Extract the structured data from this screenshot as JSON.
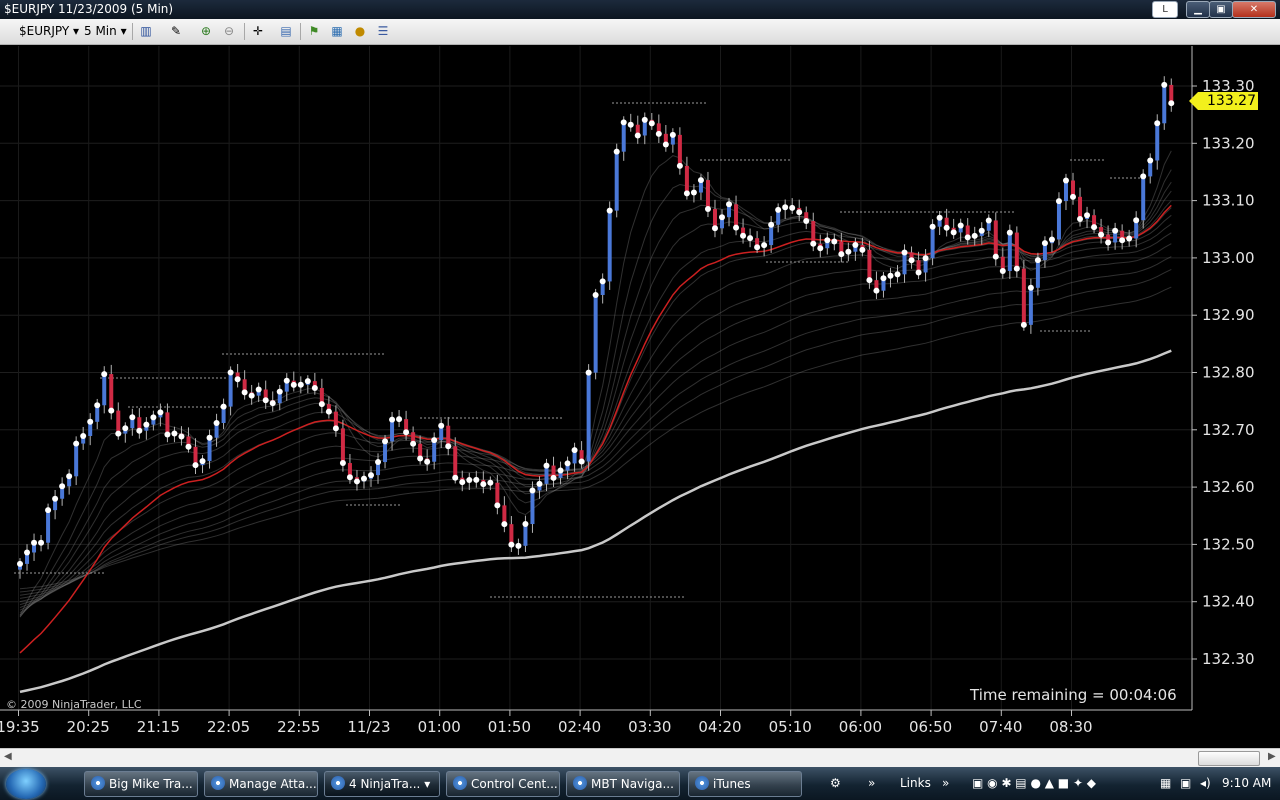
{
  "window": {
    "title": "$EURJPY  11/23/2009 (5 Min)",
    "btn_l": "L",
    "btn_min": "▁",
    "btn_max": "▣",
    "btn_close": "✕"
  },
  "toolbar": {
    "instrument": "$EURJPY",
    "interval": "5 Min"
  },
  "chart": {
    "price_axis_labels": [
      "133.30",
      "133.20",
      "133.10",
      "133.00",
      "132.90",
      "132.80",
      "132.70",
      "132.60",
      "132.50",
      "132.40",
      "132.30"
    ],
    "time_axis_labels": [
      "19:35",
      "20:25",
      "21:15",
      "22:05",
      "22:55",
      "11/23",
      "01:00",
      "01:50",
      "02:40",
      "03:30",
      "04:20",
      "05:10",
      "06:00",
      "06:50",
      "07:40",
      "08:30"
    ],
    "last_price": "133.27",
    "copyright": "© 2009 NinjaTrader, LLC",
    "time_remaining": "Time remaining = 00:04:06",
    "colors": {
      "up": "#4a78d8",
      "down": "#d02a44",
      "ema": "#cc2020",
      "ribbon": "#8a8a8a",
      "price_marker": "#f2f01c"
    }
  },
  "taskbar": {
    "items": [
      "Big Mike Tra...",
      "Manage Atta...",
      "4 NinjaTra...",
      "Control Cent...",
      "MBT Naviga...",
      "iTunes"
    ],
    "links": "Links",
    "clock": "9:10 AM"
  }
}
